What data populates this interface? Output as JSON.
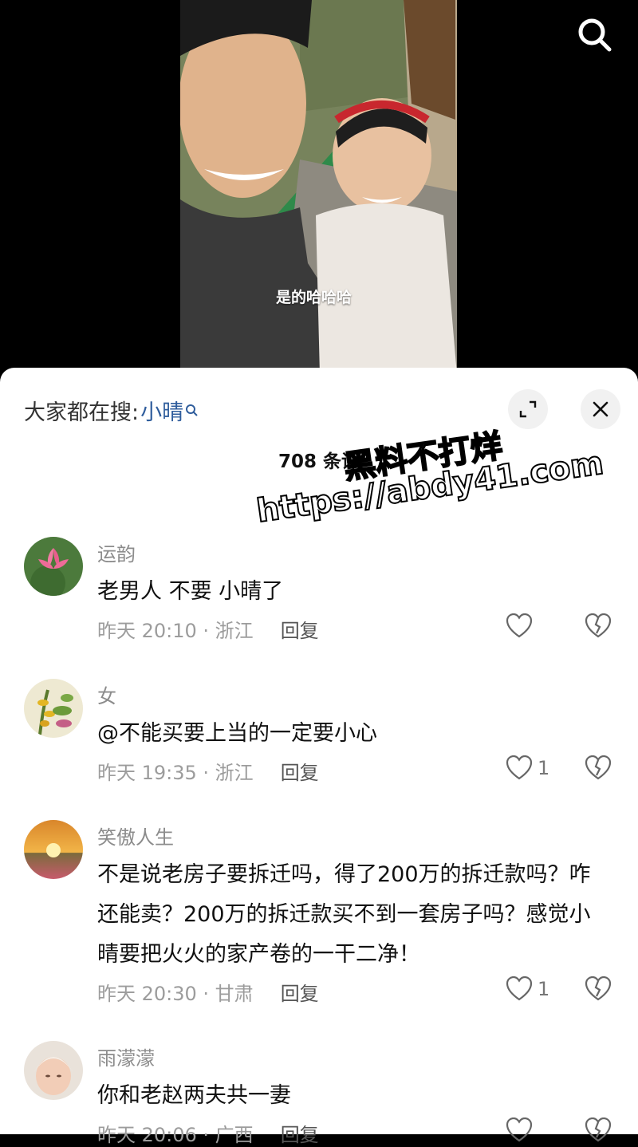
{
  "video": {
    "subtitle": "是的哈哈哈"
  },
  "sheet": {
    "trending_prefix": "大家都在搜:",
    "trending_keyword": "小晴",
    "comment_count": "708 条评"
  },
  "watermark": {
    "line1": "黑料不打烊",
    "line2": "https://abdy41.com"
  },
  "comments": [
    {
      "username": "运韵",
      "text": "老男人 不要 小晴了",
      "meta": "昨天 20:10 · 浙江",
      "reply": "回复",
      "likes": ""
    },
    {
      "username": "女",
      "text": "@不能买要上当的一定要小心",
      "meta": "昨天 19:35 · 浙江",
      "reply": "回复",
      "likes": "1"
    },
    {
      "username": "笑傲人生",
      "text": "不是说老房子要拆迁吗，得了200万的拆迁款吗？咋还能卖？200万的拆迁款买不到一套房子吗？感觉小晴要把火火的家产卷的一干二净！",
      "meta": "昨天 20:30 · 甘肃",
      "reply": "回复",
      "likes": "1"
    },
    {
      "username": "雨濛濛",
      "text": "你和老赵两夫共一妻",
      "meta": "昨天 20:06 · 广西",
      "reply": "回复",
      "likes": ""
    }
  ],
  "icons": {
    "search": "search-icon",
    "expand": "expand-icon",
    "close": "close-icon",
    "like": "heart-icon",
    "dislike": "broken-heart-icon"
  }
}
